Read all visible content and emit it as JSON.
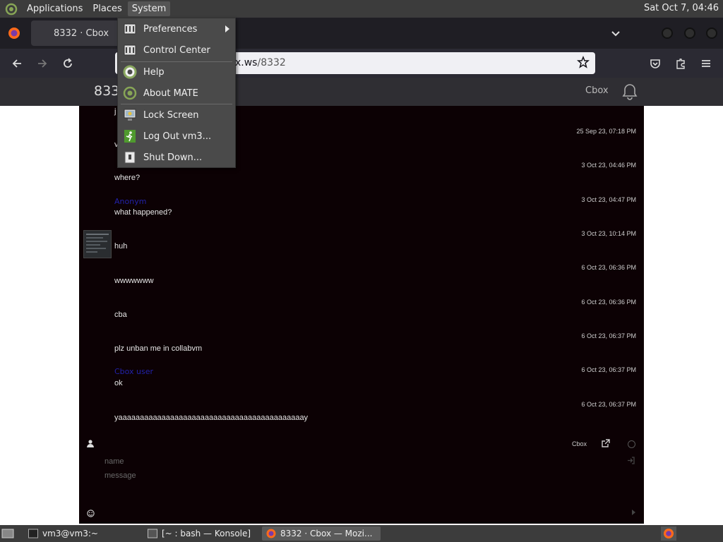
{
  "top_panel": {
    "menus": [
      "Applications",
      "Places",
      "System"
    ],
    "clock": "Sat Oct  7, 04:46"
  },
  "browser": {
    "tab_title": "8332 · Cbox",
    "url_prefix": "x.ws",
    "url_path": "/8332"
  },
  "cbox_header": {
    "title": "833",
    "brand": "Cbox"
  },
  "system_menu": {
    "items": [
      {
        "label": "Preferences",
        "icon": "preferences-icon"
      },
      {
        "label": "Control Center",
        "icon": "control-center-icon"
      },
      {
        "label": "Help",
        "icon": "help-icon"
      },
      {
        "label": "About MATE",
        "icon": "mate-icon"
      },
      {
        "label": "Lock Screen",
        "icon": "lock-screen-icon"
      },
      {
        "label": "Log Out vm3...",
        "icon": "log-out-icon"
      },
      {
        "label": "Shut Down...",
        "icon": "shut-down-icon"
      }
    ]
  },
  "chat": {
    "messages": [
      {
        "name": "",
        "text": "j",
        "time": ""
      },
      {
        "name": "",
        "text": "v",
        "time": "25 Sep 23, 07:18 PM"
      },
      {
        "name": "",
        "text": "where?",
        "time": "3 Oct 23, 04:46 PM"
      },
      {
        "name": "Anonym",
        "text": "what happened?",
        "time": "3 Oct 23, 04:47 PM"
      },
      {
        "name": "",
        "text": "huh",
        "time": "3 Oct 23, 10:14 PM"
      },
      {
        "name": "",
        "text": "wwwwwww",
        "time": "6 Oct 23, 06:36 PM"
      },
      {
        "name": "",
        "text": "cba",
        "time": "6 Oct 23, 06:36 PM"
      },
      {
        "name": "",
        "text": "plz unban me in collabvm",
        "time": "6 Oct 23, 06:37 PM"
      },
      {
        "name": "Cbox user",
        "text": "ok",
        "time": "6 Oct 23, 06:37 PM"
      },
      {
        "name": "",
        "text": "yaaaaaaaaaaaaaaaaaaaaaaaaaaaaaaaaaaaaaaaaaaay",
        "time": "6 Oct 23, 06:37 PM"
      }
    ],
    "footer_brand": "Cbox",
    "name_placeholder": "name",
    "message_placeholder": "message"
  },
  "taskbar": {
    "tasks": [
      "vm3@vm3:~",
      "[~ : bash — Konsole]",
      "8332 · Cbox — Mozi..."
    ]
  }
}
